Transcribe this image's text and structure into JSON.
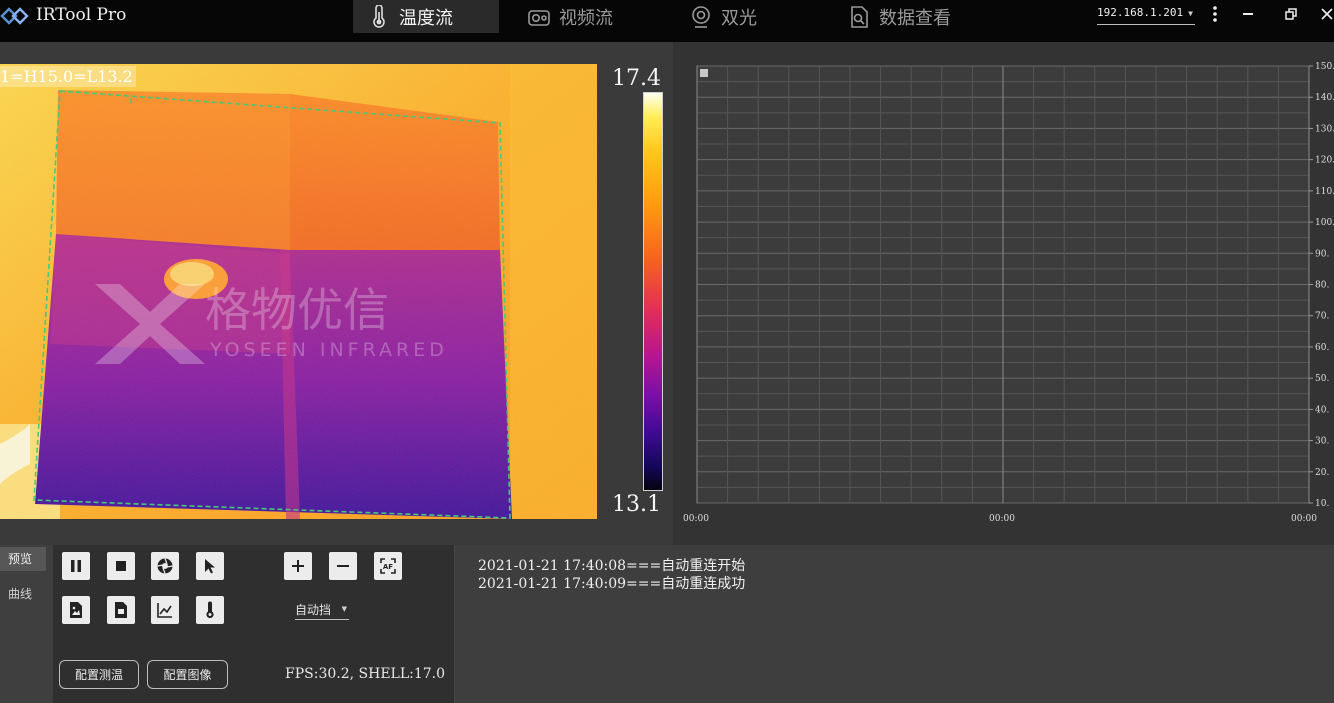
{
  "app": {
    "title": "IRTool Pro"
  },
  "tabs": [
    {
      "label": "温度流",
      "icon": "thermometer-icon",
      "active": true
    },
    {
      "label": "视频流",
      "icon": "camera-icon",
      "active": false
    },
    {
      "label": "双光",
      "icon": "webcam-icon",
      "active": false
    },
    {
      "label": "数据查看",
      "icon": "document-search-icon",
      "active": false
    }
  ],
  "connection": {
    "ip": "192.168.1.201"
  },
  "window_controls": {
    "minimize": "minimize-icon",
    "restore": "restore-icon",
    "close": "close-icon"
  },
  "thermal": {
    "roi_label": "1=H15.0=L13.2",
    "scale_max": "17.4",
    "scale_min": "13.1",
    "watermark_logo": "格物优信 YOSEEN INFRARED"
  },
  "chart_data": {
    "type": "line",
    "title": "",
    "xlabel": "",
    "ylabel": "",
    "y_ticks": [
      "150.",
      "140.",
      "130.",
      "120.",
      "110.",
      "100.",
      "90.",
      "80.",
      "70.",
      "60.",
      "50.",
      "40.",
      "30.",
      "20.",
      "10."
    ],
    "x_ticks": [
      "00:00",
      "00:00",
      "00:00"
    ],
    "ylim": [
      10,
      150
    ],
    "grid": true,
    "series": []
  },
  "side_tabs": [
    {
      "label": "预览",
      "active": true
    },
    {
      "label": "曲线",
      "active": false
    }
  ],
  "toolbar": {
    "buttons_row1": [
      "pause-icon",
      "stop-icon",
      "aperture-icon",
      "cursor-icon"
    ],
    "buttons_row2": [
      "image-export-icon",
      "document-export-icon",
      "chart-icon",
      "thermometer-icon"
    ],
    "zoom_buttons": [
      "plus-icon",
      "minus-icon",
      "focus-af-icon"
    ],
    "mode_select": "自动挡",
    "config_measure": "配置测温",
    "config_image": "配置图像",
    "fps_status": "FPS:30.2, SHELL:17.0"
  },
  "log": [
    "2021-01-21 17:40:08===自动重连开始",
    "2021-01-21 17:40:09===自动重连成功"
  ]
}
